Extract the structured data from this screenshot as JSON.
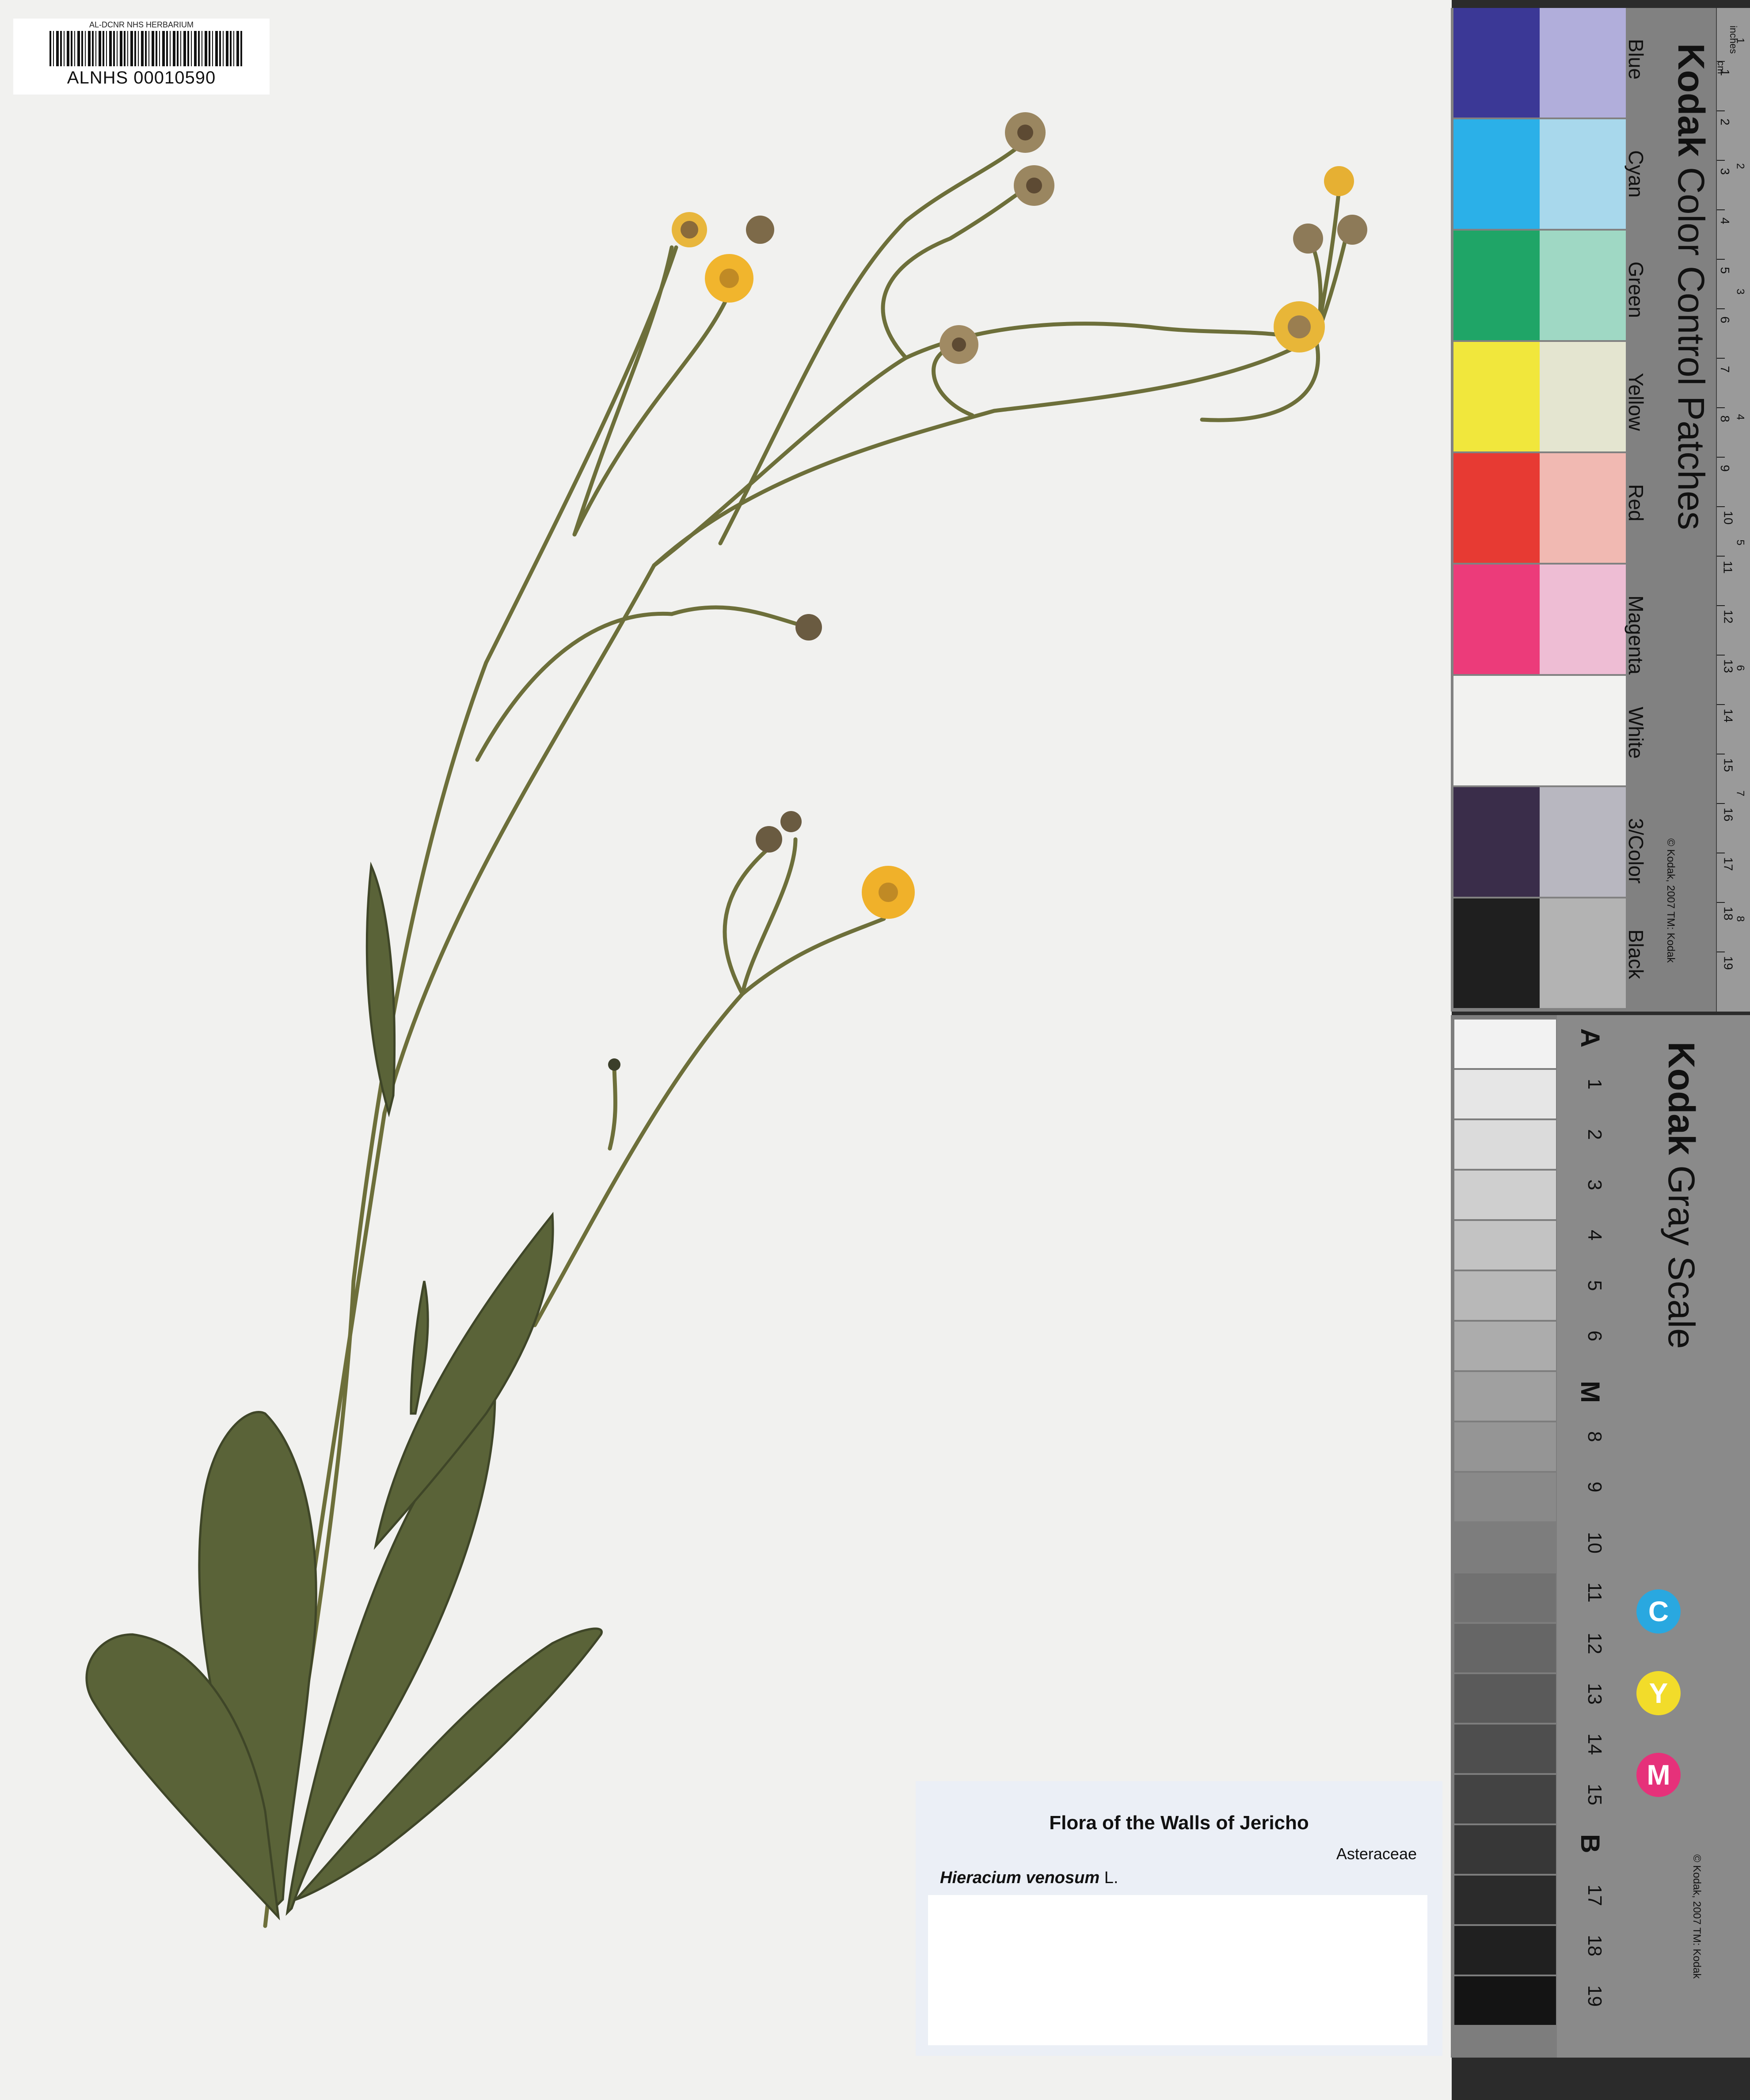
{
  "barcode": {
    "institution": "AL-DCNR NHS HERBARIUM",
    "number": "ALNHS 00010590"
  },
  "label": {
    "title": "Flora of  the Walls of Jericho",
    "family": "Asteraceae",
    "species_italic": "Hieracium venosum",
    "species_author": "L."
  },
  "color_card": {
    "brand": "Kodak",
    "title": "Color Control Patches",
    "copyright": "© Kodak, 2007 TM: Kodak",
    "unit_cm": "cm",
    "unit_inches": "inches",
    "patches": [
      {
        "name": "Blue",
        "left": "#3b3896",
        "right": "#b1aedb"
      },
      {
        "name": "Cyan",
        "left": "#2bb0e8",
        "right": "#a8d8ec"
      },
      {
        "name": "Green",
        "left": "#1fa567",
        "right": "#9fd8c4"
      },
      {
        "name": "Yellow",
        "left": "#f1e73c",
        "right": "#e4e5d0"
      },
      {
        "name": "Red",
        "left": "#e73a33",
        "right": "#f1b9b2"
      },
      {
        "name": "Magenta",
        "left": "#ec3b7a",
        "right": "#eebdd4"
      },
      {
        "name": "White",
        "left": "#f2f2f0",
        "right": "#f2f2f0"
      },
      {
        "name": "3/Color",
        "left": "#3a2d4a",
        "right": "#b8b7c0"
      },
      {
        "name": "Black",
        "left": "#1f1f1f",
        "right": "#b3b3b3"
      }
    ],
    "cm_numbers": [
      "1",
      "2",
      "3",
      "4",
      "5",
      "6",
      "7",
      "8",
      "9",
      "10",
      "11",
      "12",
      "13",
      "14",
      "15",
      "16",
      "17",
      "18",
      "19"
    ],
    "inch_numbers": [
      "1",
      "2",
      "3",
      "4",
      "5",
      "6",
      "7",
      "8"
    ]
  },
  "gray_card": {
    "brand": "Kodak",
    "title": "Gray Scale",
    "copyright": "© Kodak, 2007 TM: Kodak",
    "steps": [
      "A",
      "1",
      "2",
      "3",
      "4",
      "5",
      "6",
      "M",
      "8",
      "9",
      "10",
      "11",
      "12",
      "13",
      "14",
      "15",
      "B",
      "17",
      "18",
      "19"
    ],
    "cym": [
      {
        "letter": "C",
        "color": "#29a8e0"
      },
      {
        "letter": "Y",
        "color": "#f2dc2a"
      },
      {
        "letter": "M",
        "color": "#e6317a"
      }
    ]
  }
}
